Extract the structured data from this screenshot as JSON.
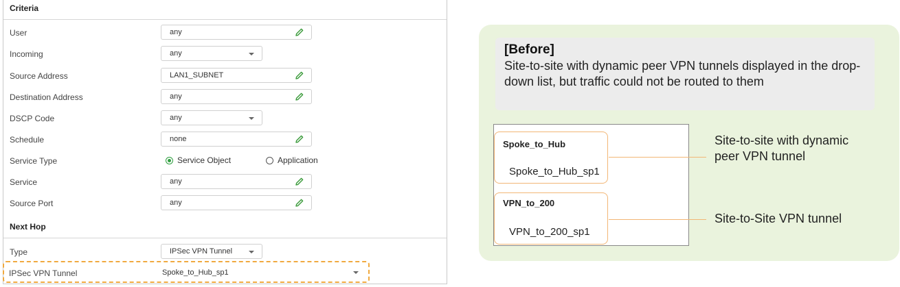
{
  "criteria": {
    "header": "Criteria",
    "rows": [
      {
        "label": "User",
        "value": "any",
        "kind": "edit"
      },
      {
        "label": "Incoming",
        "value": "any",
        "kind": "select"
      },
      {
        "label": "Source Address",
        "value": "LAN1_SUBNET",
        "kind": "edit"
      },
      {
        "label": "Destination Address",
        "value": "any",
        "kind": "edit"
      },
      {
        "label": "DSCP Code",
        "value": "any",
        "kind": "select"
      },
      {
        "label": "Schedule",
        "value": "none",
        "kind": "edit"
      },
      {
        "label": "Service Type",
        "kind": "radio"
      },
      {
        "label": "Service",
        "value": "any",
        "kind": "edit"
      },
      {
        "label": "Source Port",
        "value": "any",
        "kind": "edit"
      }
    ],
    "service_type_options": [
      {
        "label": "Service Object",
        "selected": true
      },
      {
        "label": "Application",
        "selected": false
      }
    ]
  },
  "next_hop": {
    "header": "Next Hop",
    "type_label": "Type",
    "type_value": "IPSec VPN Tunnel",
    "tunnel_label": "IPSec VPN Tunnel",
    "tunnel_value": "Spoke_to_Hub_sp1"
  },
  "explanation": {
    "before_title": "[Before]",
    "before_desc": "Site-to-site with dynamic peer VPN tunnels displayed in the drop-down list, but traffic could not be routed to them",
    "groups": [
      {
        "title": "Spoke_to_Hub",
        "item": "Spoke_to_Hub_sp1",
        "callout": "Site-to-site with dynamic peer VPN tunnel"
      },
      {
        "title": "VPN_to_200",
        "item": "VPN_to_200_sp1",
        "callout": "Site-to-Site VPN tunnel"
      }
    ]
  },
  "colors": {
    "highlight": "#f0a93f",
    "radio_selected": "#2e9e3f",
    "pencil": "#3a9a3a",
    "panel_bg": "#eaf3dd",
    "group_border": "#f2b675"
  },
  "icons": {
    "edit": "pencil-icon",
    "dropdown": "caret-down-icon"
  }
}
